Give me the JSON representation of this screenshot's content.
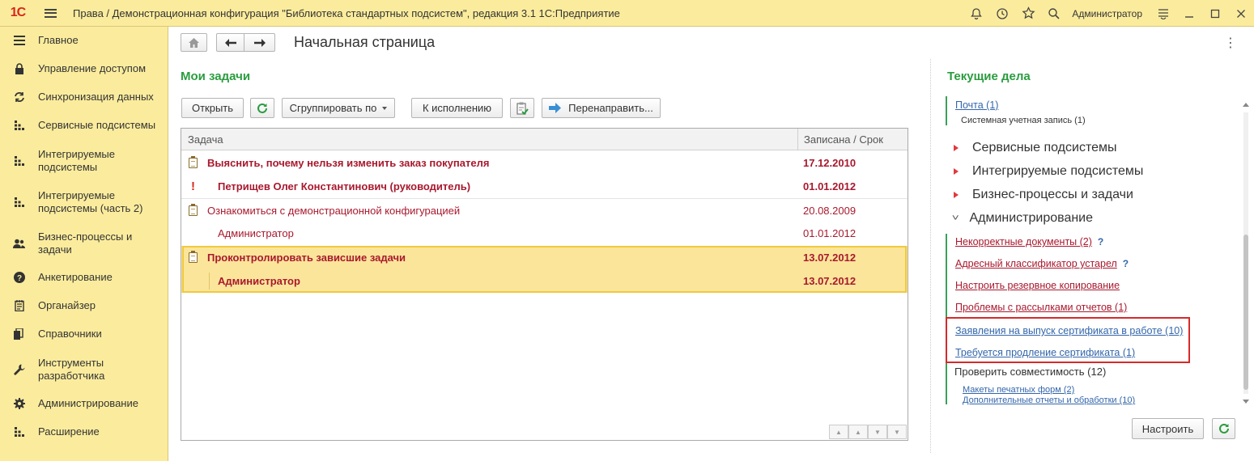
{
  "app": {
    "logo_text": "1С",
    "window_title": "Права / Демонстрационная конфигурация \"Библиотека стандартных подсистем\", редакция 3.1 1С:Предприятие",
    "user_name": "Администратор"
  },
  "sidebar": {
    "items": [
      {
        "label": "Главное",
        "icon": "menu-lines-icon"
      },
      {
        "label": "Управление доступом",
        "icon": "lock-icon"
      },
      {
        "label": "Синхронизация данных",
        "icon": "sync-icon"
      },
      {
        "label": "Сервисные подсистемы",
        "icon": "grid-dots-icon"
      },
      {
        "label": "Интегрируемые подсистемы",
        "icon": "grid-dots-icon"
      },
      {
        "label": "Интегрируемые подсистемы (часть 2)",
        "icon": "grid-dots-icon"
      },
      {
        "label": "Бизнес-процессы и задачи",
        "icon": "users-icon"
      },
      {
        "label": "Анкетирование",
        "icon": "question-icon"
      },
      {
        "label": "Органайзер",
        "icon": "notepad-icon"
      },
      {
        "label": "Справочники",
        "icon": "books-icon"
      },
      {
        "label": "Инструменты разработчика",
        "icon": "wrench-icon"
      },
      {
        "label": "Администрирование",
        "icon": "gear-icon"
      },
      {
        "label": "Расширение",
        "icon": "grid-dots-icon"
      }
    ]
  },
  "page": {
    "title": "Начальная страница"
  },
  "tasks": {
    "section_title": "Мои задачи",
    "toolbar": {
      "open": "Открыть",
      "group_by": "Сгруппировать по",
      "execute": "К исполнению",
      "redirect": "Перенаправить..."
    },
    "columns": {
      "task": "Задача",
      "date": "Записана / Срок"
    },
    "rows": [
      {
        "text": "Выяснить, почему нельзя изменить заказ покупателя",
        "date": "17.12.2010"
      },
      {
        "text": "Петрищев Олег Константинович (руководитель)",
        "date": "01.01.2012"
      },
      {
        "text": "Ознакомиться с демонстрационной конфигурацией",
        "date": "20.08.2009"
      },
      {
        "text": "Администратор",
        "date": "01.01.2012"
      },
      {
        "text": "Проконтролировать зависшие задачи",
        "date": "13.07.2012"
      },
      {
        "text": "Администратор",
        "date": "13.07.2012"
      }
    ]
  },
  "current": {
    "section_title": "Текущие дела",
    "mail": {
      "link": "Почта (1)",
      "sub": "Системная учетная запись (1)"
    },
    "categories": [
      "Сервисные подсистемы",
      "Интегрируемые подсистемы",
      "Бизнес-процессы и задачи",
      "Администрирование"
    ],
    "admin_items": [
      {
        "text": "Некорректные документы (2)",
        "hint": "?"
      },
      {
        "text": "Адресный классификатор устарел",
        "hint": "?"
      },
      {
        "text": "Настроить резервное копирование"
      },
      {
        "text": "Проблемы с рассылками отчетов (1)"
      },
      {
        "text": "Заявления на выпуск сертификата в работе (10)"
      },
      {
        "text": "Требуется продление сертификата (1)"
      }
    ],
    "compat": {
      "title": "Проверить совместимость (12)",
      "sub": [
        "Макеты печатных форм (2)",
        "Дополнительные отчеты и обработки (10)"
      ]
    },
    "settings_button": "Настроить"
  }
}
